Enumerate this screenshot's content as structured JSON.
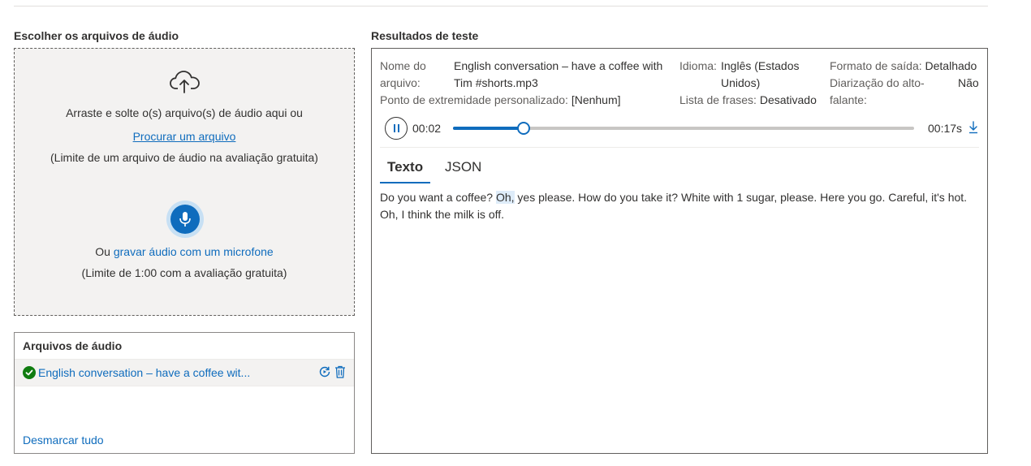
{
  "upload": {
    "title": "Escolher os arquivos de áudio",
    "drag_text": "Arraste e solte o(s) arquivo(s) de áudio aqui ou",
    "browse_link": "Procurar um arquivo",
    "limit_file": "(Limite de um arquivo de áudio na avaliação gratuita)",
    "record_prefix": "Ou",
    "record_link": "gravar áudio com um microfone",
    "limit_time": "(Limite de 1:00 com a avaliação gratuita)"
  },
  "files": {
    "title": "Arquivos de áudio",
    "items": [
      {
        "name": "English conversation – have a coffee wit...",
        "status": "success"
      }
    ],
    "deselect_all": "Desmarcar tudo"
  },
  "results": {
    "title": "Resultados de teste",
    "file_name_label_1": "Nome do",
    "file_name_label_2": "arquivo:",
    "file_name_value_1": "English conversation – have a coffee with",
    "file_name_value_2": "Tim #shorts.mp3",
    "endpoint_label": "Ponto de extremidade personalizado:",
    "endpoint_value": "[Nenhum]",
    "language_label": "Idioma:",
    "language_value_1": "Inglês (Estados",
    "language_value_2": "Unidos)",
    "phrase_list_label": "Lista de frases:",
    "phrase_list_value": "Desativado",
    "output_format_label": "Formato de saída:",
    "output_format_value": "Detalhado",
    "diarization_label_1": "Diarização do alto-",
    "diarization_label_2": "falante:",
    "diarization_value": "Não",
    "player": {
      "current_time": "00:02",
      "total_time": "00:17s",
      "progress": 0.153
    },
    "tabs": [
      {
        "label": "Texto",
        "active": true
      },
      {
        "label": "JSON",
        "active": false
      }
    ],
    "transcript_before": "Do you want a coffee? ",
    "transcript_highlight": "Oh,",
    "transcript_after": " yes please. How do you take it? White with 1 sugar, please. Here you go. Careful, it's hot. Oh, I think the milk is off."
  },
  "colors": {
    "accent": "#0f6cbd",
    "success": "#107c10",
    "panel_bg": "#f3f2f1"
  },
  "icons": [
    "cloud-upload-icon",
    "microphone-icon",
    "checkmark-circle-icon",
    "retry-icon",
    "trash-icon",
    "pause-icon",
    "download-icon"
  ]
}
